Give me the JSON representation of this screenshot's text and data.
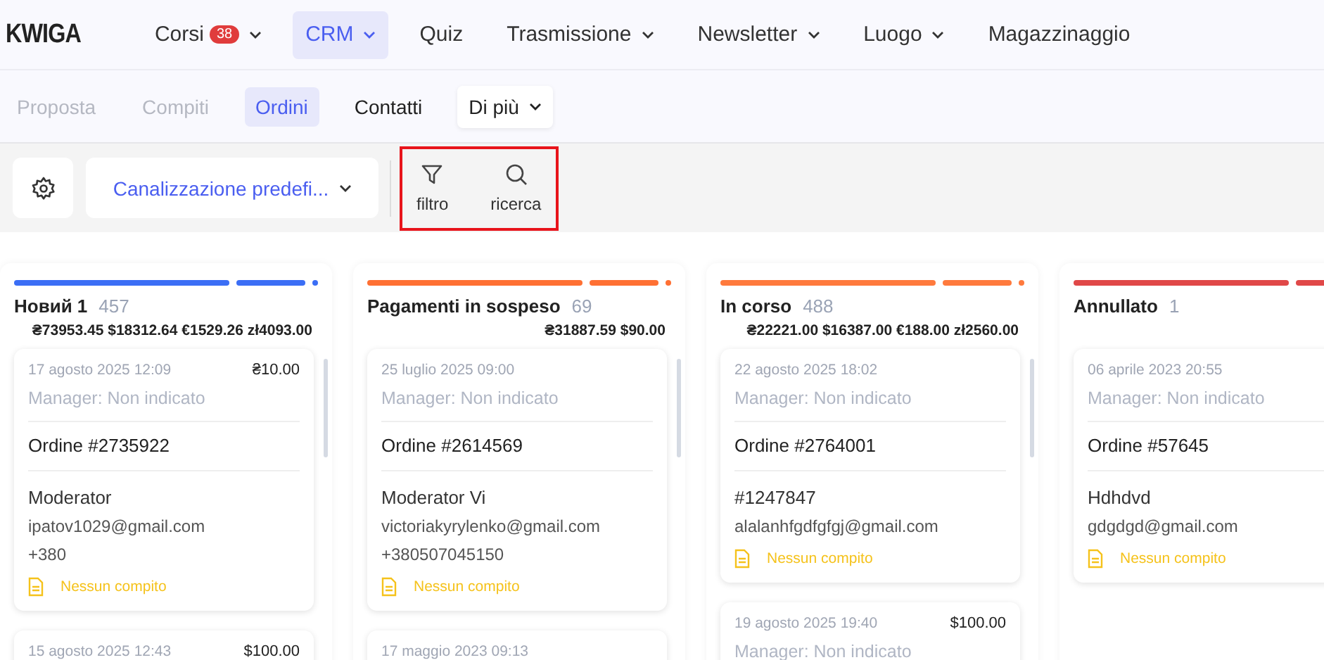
{
  "logo": "KWIGA",
  "nav": [
    {
      "label": "Corsi",
      "badge": "38",
      "dropdown": true,
      "selected": false
    },
    {
      "label": "CRM",
      "dropdown": true,
      "selected": true
    },
    {
      "label": "Quiz",
      "dropdown": false,
      "selected": false
    },
    {
      "label": "Trasmissione",
      "dropdown": true,
      "selected": false
    },
    {
      "label": "Newsletter",
      "dropdown": true,
      "selected": false
    },
    {
      "label": "Luogo",
      "dropdown": true,
      "selected": false
    },
    {
      "label": "Magazzinaggio",
      "dropdown": false,
      "selected": false
    }
  ],
  "tabs": [
    {
      "label": "Proposta",
      "selected": false,
      "disabled": true,
      "dropdown": false
    },
    {
      "label": "Compiti",
      "selected": false,
      "disabled": true,
      "dropdown": false
    },
    {
      "label": "Ordini",
      "selected": true,
      "disabled": false,
      "dropdown": false
    },
    {
      "label": "Contatti",
      "selected": false,
      "disabled": false,
      "dropdown": false
    },
    {
      "label": "Di più",
      "selected": false,
      "disabled": false,
      "dropdown": true
    }
  ],
  "toolbar": {
    "pipeline": "Canalizzazione predefi...",
    "actions": [
      {
        "kind": "filter",
        "label": "filtro"
      },
      {
        "kind": "search",
        "label": "ricerca"
      }
    ]
  },
  "columns": [
    {
      "title": "Новий 1",
      "count": "457",
      "color": "#3b6ef5",
      "totals": "₴73953.45 $18312.64 €1529.26 zł4093.00",
      "cards": [
        {
          "date": "17 agosto 2025 12:09",
          "amount": "₴10.00",
          "manager": "Manager: Non indicato",
          "order": "Ordine #2735922",
          "name": "Moderator",
          "email": "ipatov1029@gmail.com",
          "phone": "+380",
          "task": "Nessun compito"
        },
        {
          "date": "15 agosto 2025 12:43",
          "amount": "$100.00"
        }
      ]
    },
    {
      "title": "Pagamenti in sospeso",
      "count": "69",
      "color": "#ff7033",
      "totals": "₴31887.59 $90.00",
      "cards": [
        {
          "date": "25 luglio 2025 09:00",
          "manager": "Manager: Non indicato",
          "order": "Ordine #2614569",
          "name": "Moderator Vi",
          "email": "victoriakyrylenko@gmail.com",
          "phone": "+380507045150",
          "task": "Nessun compito"
        },
        {
          "date": "17 maggio 2023 09:13"
        }
      ]
    },
    {
      "title": "In corso",
      "count": "488",
      "color": "#ff7a3d",
      "totals": "₴22221.00 $16387.00 €188.00 zł2560.00",
      "cards": [
        {
          "date": "22 agosto 2025 18:02",
          "manager": "Manager: Non indicato",
          "order": "Ordine #2764001",
          "name": "#1247847",
          "email": "alalanhfgdfgfgj@gmail.com",
          "task": "Nessun compito"
        },
        {
          "date": "19 agosto 2025 19:40",
          "amount": "$100.00",
          "manager": "Manager: Non indicato"
        }
      ]
    },
    {
      "title": "Annullato",
      "count": "1",
      "color": "#e04848",
      "cards": [
        {
          "date": "06 aprile 2023 20:55",
          "manager": "Manager: Non indicato",
          "order": "Ordine #57645",
          "name": "Hdhdvd",
          "email": "gdgdgd@gmail.com",
          "task": "Nessun compito"
        }
      ]
    }
  ]
}
